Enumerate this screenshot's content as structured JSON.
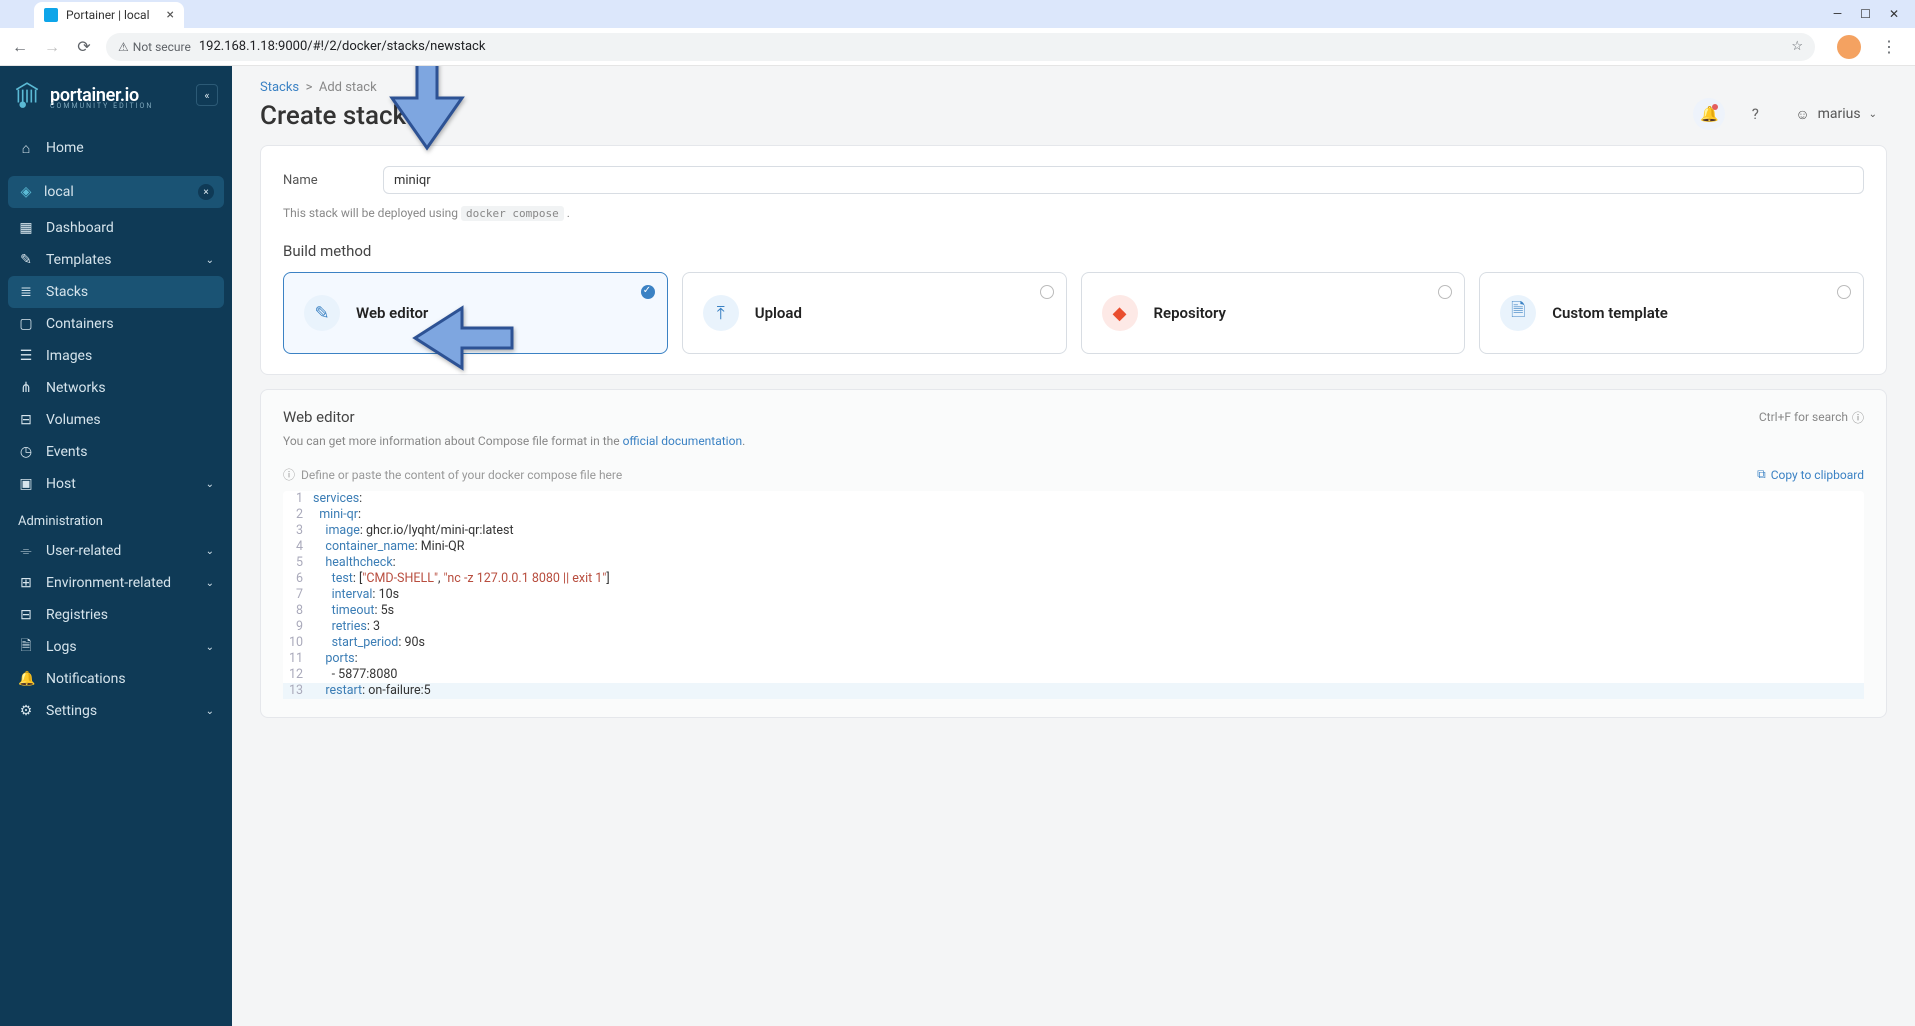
{
  "browser": {
    "tab_title": "Portainer | local",
    "security_label": "Not secure",
    "url": "192.168.1.18:9000/#!/2/docker/stacks/newstack"
  },
  "logo": {
    "name": "portainer.io",
    "edition": "COMMUNITY EDITION"
  },
  "sidebar": {
    "home": "Home",
    "env_label": "local",
    "items": [
      "Dashboard",
      "Templates",
      "Stacks",
      "Containers",
      "Images",
      "Networks",
      "Volumes",
      "Events",
      "Host"
    ],
    "admin_label": "Administration",
    "admin_items": [
      "User-related",
      "Environment-related",
      "Registries",
      "Logs",
      "Notifications",
      "Settings"
    ]
  },
  "breadcrumb": {
    "root": "Stacks",
    "current": "Add stack"
  },
  "page_title": "Create stack",
  "user": "marius",
  "form": {
    "name_label": "Name",
    "name_value": "miniqr",
    "help_pre": "This stack will be deployed using ",
    "help_code": "docker compose",
    "build_method_label": "Build method",
    "methods": [
      "Web editor",
      "Upload",
      "Repository",
      "Custom template"
    ]
  },
  "editor": {
    "title": "Web editor",
    "search_hint": "Ctrl+F for search",
    "desc_pre": "You can get more information about Compose file format in the ",
    "desc_link": "official documentation",
    "placeholder_hint": "Define or paste the content of your docker compose file here",
    "copy_label": "Copy to clipboard",
    "lines": [
      [
        [
          "key",
          "services"
        ],
        [
          "punc",
          ":"
        ]
      ],
      [
        [
          "pad",
          "  "
        ],
        [
          "key",
          "mini-qr"
        ],
        [
          "punc",
          ":"
        ]
      ],
      [
        [
          "pad",
          "    "
        ],
        [
          "key",
          "image"
        ],
        [
          "punc",
          ": "
        ],
        [
          "val",
          "ghcr.io/lyqht/mini-qr:latest"
        ]
      ],
      [
        [
          "pad",
          "    "
        ],
        [
          "key",
          "container_name"
        ],
        [
          "punc",
          ": "
        ],
        [
          "val",
          "Mini-QR"
        ]
      ],
      [
        [
          "pad",
          "    "
        ],
        [
          "key",
          "healthcheck"
        ],
        [
          "punc",
          ":"
        ]
      ],
      [
        [
          "pad",
          "      "
        ],
        [
          "key",
          "test"
        ],
        [
          "punc",
          ": ["
        ],
        [
          "str",
          "\"CMD-SHELL\""
        ],
        [
          "punc",
          ", "
        ],
        [
          "str",
          "\"nc -z 127.0.0.1 8080 || exit 1\""
        ],
        [
          "punc",
          "]"
        ]
      ],
      [
        [
          "pad",
          "      "
        ],
        [
          "key",
          "interval"
        ],
        [
          "punc",
          ": "
        ],
        [
          "val",
          "10s"
        ]
      ],
      [
        [
          "pad",
          "      "
        ],
        [
          "key",
          "timeout"
        ],
        [
          "punc",
          ": "
        ],
        [
          "val",
          "5s"
        ]
      ],
      [
        [
          "pad",
          "      "
        ],
        [
          "key",
          "retries"
        ],
        [
          "punc",
          ": "
        ],
        [
          "val",
          "3"
        ]
      ],
      [
        [
          "pad",
          "      "
        ],
        [
          "key",
          "start_period"
        ],
        [
          "punc",
          ": "
        ],
        [
          "val",
          "90s"
        ]
      ],
      [
        [
          "pad",
          "    "
        ],
        [
          "key",
          "ports"
        ],
        [
          "punc",
          ":"
        ]
      ],
      [
        [
          "pad",
          "      "
        ],
        [
          "val",
          "- 5877:8080"
        ]
      ],
      [
        [
          "pad",
          "    "
        ],
        [
          "key",
          "restart"
        ],
        [
          "punc",
          ": "
        ],
        [
          "val",
          "on-failure:5"
        ]
      ]
    ]
  }
}
